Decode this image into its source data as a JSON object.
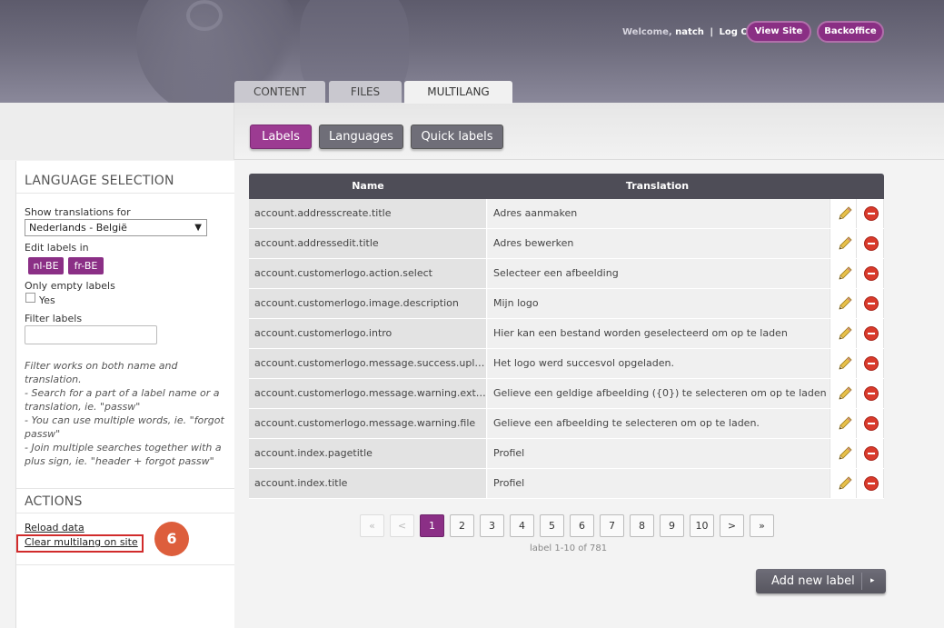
{
  "header": {
    "welcome_prefix": "Welcome,",
    "username": "natch",
    "separator": "|",
    "logout": "Log Out",
    "view_site": "View Site",
    "backoffice": "Backoffice"
  },
  "tabs": [
    {
      "label": "CONTENT",
      "active": false
    },
    {
      "label": "FILES",
      "active": false
    },
    {
      "label": "MULTILANG",
      "active": true
    }
  ],
  "subnav": {
    "labels": "Labels",
    "languages": "Languages",
    "quick_labels": "Quick labels"
  },
  "sidebar": {
    "language_selection_title": "LANGUAGE SELECTION",
    "show_translations_label": "Show translations for",
    "show_translations_value": "Nederlands - België",
    "edit_labels_label": "Edit labels in",
    "edit_langs": [
      "nl-BE",
      "fr-BE"
    ],
    "only_empty_label": "Only empty labels",
    "yes_label": "Yes",
    "filter_label": "Filter labels",
    "filter_value": "",
    "help": [
      "Filter works on both name and translation.",
      "- Search for a part of a label name or a translation, ie. \"passw\"",
      "- You can use multiple words, ie. \"forgot passw\"",
      "- Join multiple searches together with a plus sign, ie. \"header + forgot passw\""
    ],
    "actions_title": "ACTIONS",
    "reload_data": "Reload data",
    "clear_multilang": "Clear multilang on site",
    "step_number": "6"
  },
  "table": {
    "col_name": "Name",
    "col_translation": "Translation",
    "rows": [
      {
        "name": "account.addresscreate.title",
        "translation": "Adres aanmaken"
      },
      {
        "name": "account.addressedit.title",
        "translation": "Adres bewerken"
      },
      {
        "name": "account.customerlogo.action.select",
        "translation": "Selecteer een afbeelding"
      },
      {
        "name": "account.customerlogo.image.description",
        "translation": "Mijn logo"
      },
      {
        "name": "account.customerlogo.intro",
        "translation": "Hier kan een bestand worden geselecteerd om op te laden"
      },
      {
        "name": "account.customerlogo.message.success.upload",
        "translation": "Het logo werd succesvol opgeladen."
      },
      {
        "name": "account.customerlogo.message.warning.exte...",
        "translation": "Gelieve een geldige afbeelding ({0}) te selecteren om op te laden"
      },
      {
        "name": "account.customerlogo.message.warning.file",
        "translation": "Gelieve een afbeelding te selecteren om op te laden."
      },
      {
        "name": "account.index.pagetitle",
        "translation": "Profiel"
      },
      {
        "name": "account.index.title",
        "translation": "Profiel"
      }
    ]
  },
  "pagination": {
    "first": "«",
    "prev": "<",
    "pages": [
      "1",
      "2",
      "3",
      "4",
      "5",
      "6",
      "7",
      "8",
      "9",
      "10"
    ],
    "current": "1",
    "next": ">",
    "last": "»",
    "info": "label 1-10 of 781"
  },
  "add_new_label": "Add new label",
  "add_arrow": "▸",
  "colors": {
    "accent": "#8b2f86",
    "header_bg": "#6e6c7d",
    "table_header": "#4e4d57",
    "highlight": "#d12b2b",
    "step_badge": "#dd5e3c"
  }
}
